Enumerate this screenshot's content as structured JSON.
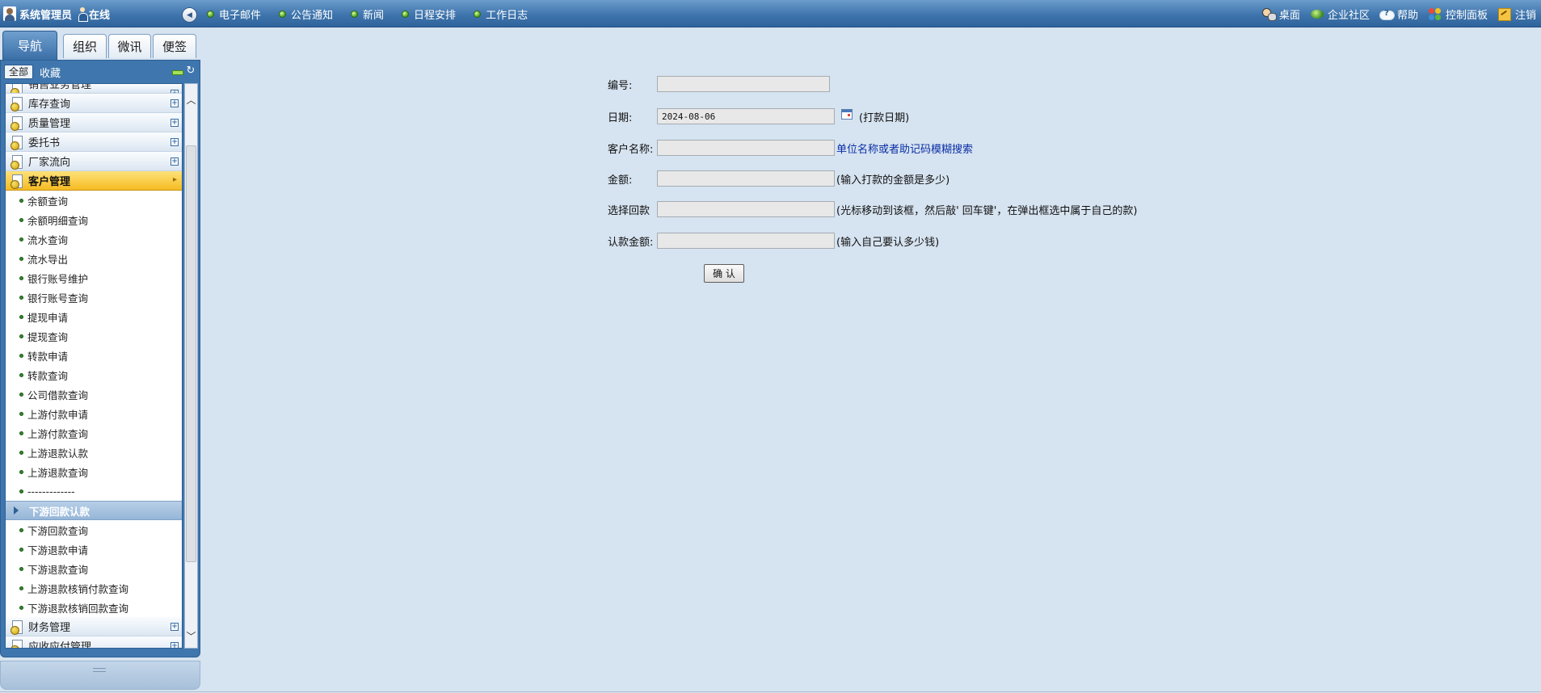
{
  "topbar": {
    "user": "系统管理员",
    "status": "在线",
    "nav": [
      {
        "label": "电子邮件",
        "icon": "green-dot-icon"
      },
      {
        "label": "公告通知",
        "icon": "green-dot-icon"
      },
      {
        "label": "新闻",
        "icon": "green-dot-icon"
      },
      {
        "label": "日程安排",
        "icon": "green-dot-icon"
      },
      {
        "label": "工作日志",
        "icon": "green-dot-icon"
      }
    ],
    "right": [
      {
        "label": "桌面",
        "icon": "desktop-icon"
      },
      {
        "label": "企业社区",
        "icon": "community-icon"
      },
      {
        "label": "帮助",
        "icon": "help-cloud-icon"
      },
      {
        "label": "控制面板",
        "icon": "control-panel-icon"
      },
      {
        "label": "注销",
        "icon": "logout-icon"
      }
    ]
  },
  "sidebar": {
    "tabs": [
      "导航",
      "组织",
      "微讯",
      "便签"
    ],
    "active_tab": "导航",
    "filter": {
      "all": "全部",
      "favorites": "收藏"
    },
    "groups_top": [
      {
        "label": "销售业务管理"
      },
      {
        "label": "库存查询"
      },
      {
        "label": "质量管理"
      },
      {
        "label": "委托书"
      },
      {
        "label": "厂家流向"
      }
    ],
    "active_group": "客户管理",
    "items": [
      "余额查询",
      "余额明细查询",
      "流水查询",
      "流水导出",
      "银行账号维护",
      "银行账号查询",
      "提现申请",
      "提现查询",
      "转款申请",
      "转款查询",
      "公司借款查询",
      "上游付款申请",
      "上游付款查询",
      "上游退款认款",
      "上游退款查询",
      "-------------"
    ],
    "subgroup": "下游回款认款",
    "sub_items": [
      "下游回款查询",
      "下游退款申请",
      "下游退款查询",
      "上游退款核销付款查询",
      "下游退款核销回款查询"
    ],
    "groups_bottom": [
      {
        "label": "财务管理"
      },
      {
        "label": "应收应付管理"
      }
    ]
  },
  "form": {
    "number": {
      "label": "编号:",
      "value": ""
    },
    "date": {
      "label": "日期:",
      "value": "2024-08-06",
      "hint": "(打款日期)"
    },
    "customer": {
      "label": "客户名称:",
      "value": "",
      "link": "单位名称或者助记码模糊搜索"
    },
    "amount": {
      "label": "金额:",
      "value": "",
      "hint": "(输入打款的金额是多少)"
    },
    "select_payment": {
      "label": "选择回款",
      "value": "",
      "hint": "(光标移动到该框，然后敲' 回车键'，在弹出框选中属于自己的款)"
    },
    "claim_amount": {
      "label": "认款金额:",
      "value": "",
      "hint": "(输入自己要认多少钱)"
    },
    "confirm_label": "确 认"
  },
  "colors": {
    "topbar": "#3f75ad",
    "background": "#d6e3f0",
    "active_group": "#f5bb22",
    "link": "#0a2fa6"
  }
}
